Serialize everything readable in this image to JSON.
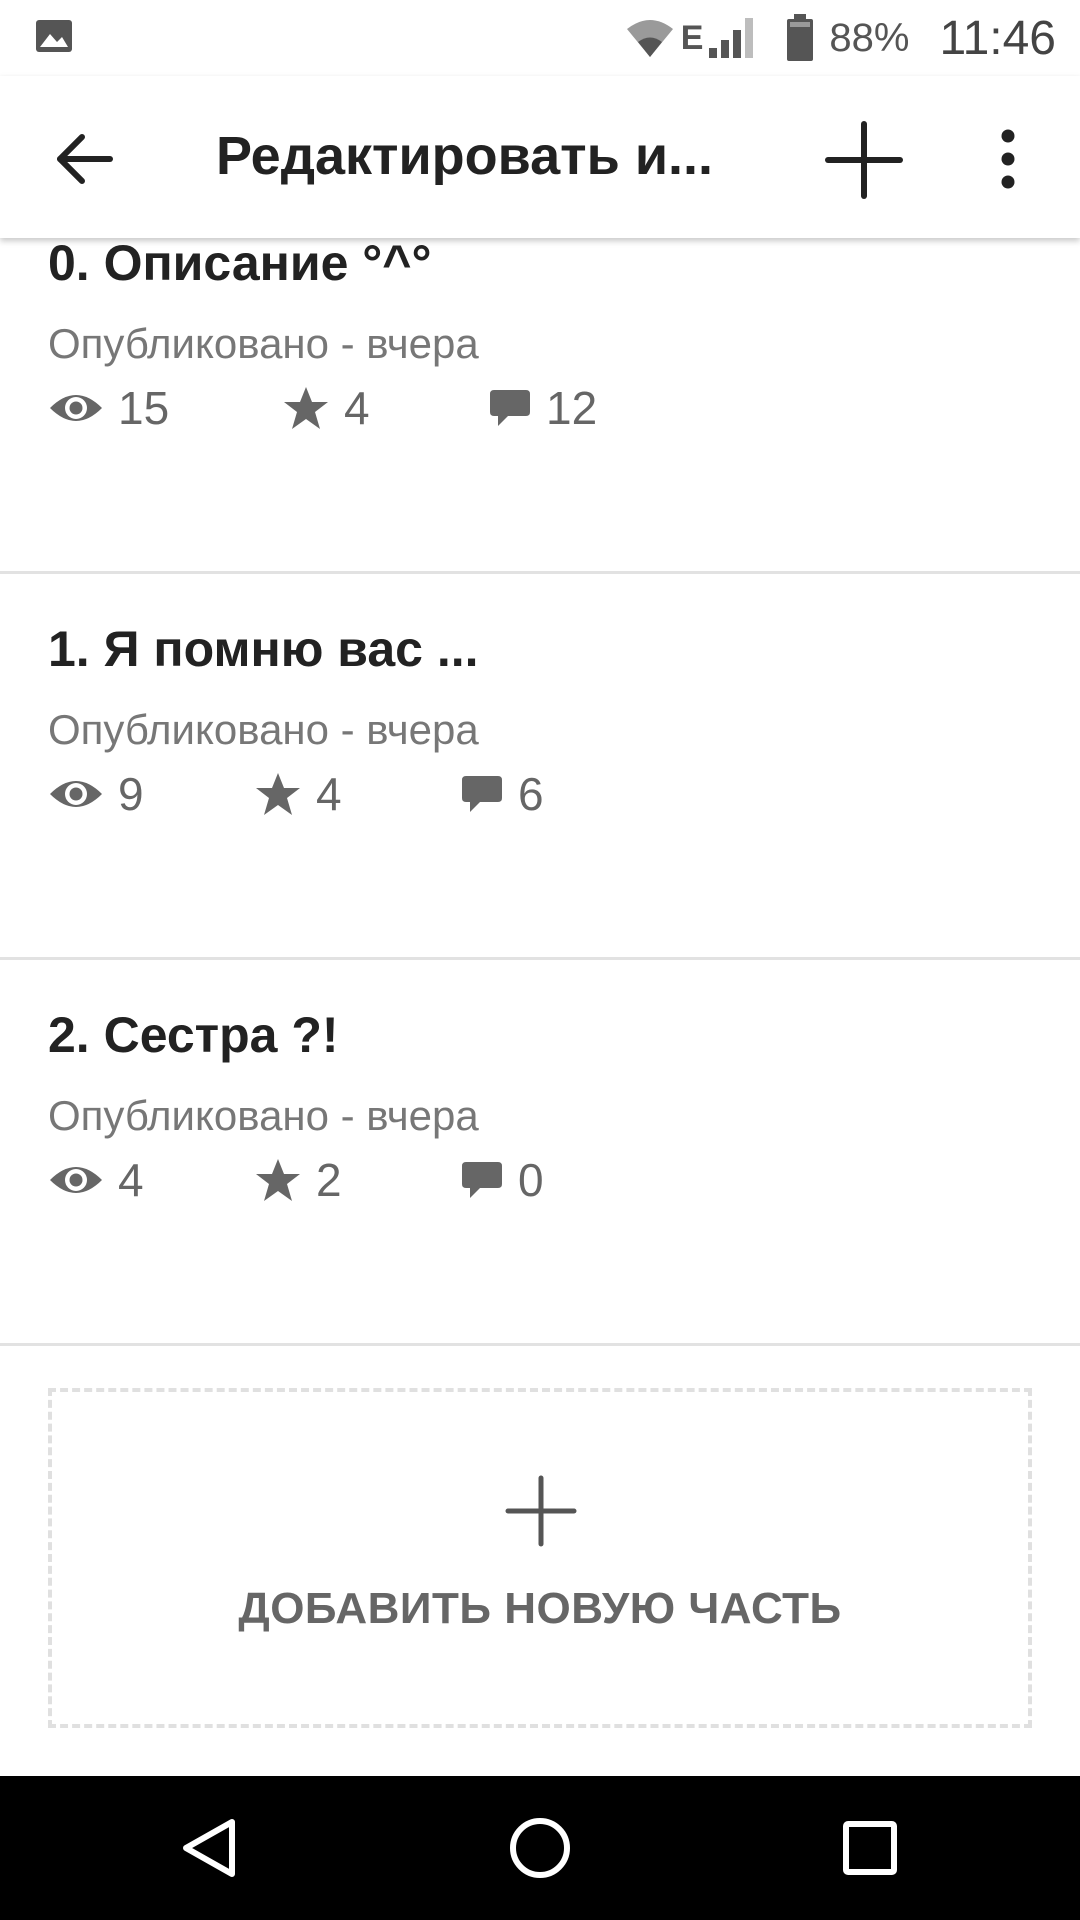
{
  "status_bar": {
    "battery_percent": "88%",
    "network_type": "E",
    "time": "11:46"
  },
  "toolbar": {
    "title": "Редактировать и...",
    "back_icon": "arrow-back-icon",
    "add_icon": "plus-icon",
    "more_icon": "more-vertical-icon"
  },
  "parts": [
    {
      "title": "0. Описание °^°",
      "status": "Опубликовано - вчера",
      "views": "15",
      "votes": "4",
      "comments": "12"
    },
    {
      "title": "1. Я помню вас ...",
      "status": "Опубликовано - вчера",
      "views": "9",
      "votes": "4",
      "comments": "6"
    },
    {
      "title": "2. Сестра ?!",
      "status": "Опубликовано - вчера",
      "views": "4",
      "votes": "2",
      "comments": "0"
    }
  ],
  "add_part": {
    "label": "ДОБАВИТЬ НОВУЮ ЧАСТЬ"
  },
  "colors": {
    "title_text": "#222222",
    "secondary_text": "#777777",
    "icon_gray": "#666666",
    "divider": "#e2e2e2",
    "nav_bar": "#000000"
  }
}
